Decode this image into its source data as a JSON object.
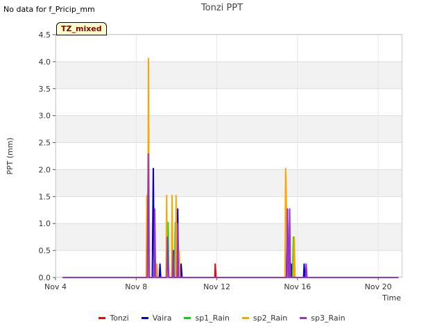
{
  "notice": "No data for f_Pricip_mm",
  "badge": "TZ_mixed",
  "chart_data": {
    "type": "line",
    "title": "Tonzi PPT",
    "xlabel": "Time",
    "ylabel": "PPT (mm)",
    "xlim": [
      4.3,
      21.5
    ],
    "ylim": [
      0,
      4.5
    ],
    "x_ticks": [
      {
        "value": 4.3,
        "label": "Nov 4"
      },
      {
        "value": 8.3,
        "label": "Nov 8"
      },
      {
        "value": 12.3,
        "label": "Nov 12"
      },
      {
        "value": 16.3,
        "label": "Nov 16"
      },
      {
        "value": 20.3,
        "label": "Nov 20"
      }
    ],
    "y_ticks": [
      "0.0",
      "0.5",
      "1.0",
      "1.5",
      "2.0",
      "2.5",
      "3.0",
      "3.5",
      "4.0",
      "4.5"
    ],
    "grid": true,
    "legend_position": "bottom",
    "series": [
      {
        "name": "Tonzi",
        "color": "#ff0000",
        "points": [
          [
            4.65,
            0
          ],
          [
            12.2,
            0
          ],
          [
            12.22,
            0.25
          ],
          [
            12.26,
            0
          ],
          [
            21.3,
            0
          ]
        ]
      },
      {
        "name": "Vaira",
        "color": "#0000cc",
        "points": [
          [
            4.65,
            0
          ],
          [
            8.85,
            0
          ],
          [
            8.88,
            0.75
          ],
          [
            8.92,
            0
          ],
          [
            9.1,
            0
          ],
          [
            9.15,
            2.02
          ],
          [
            9.19,
            0
          ],
          [
            9.45,
            0
          ],
          [
            9.48,
            0.25
          ],
          [
            9.52,
            0
          ],
          [
            10.15,
            0
          ],
          [
            10.2,
            0.5
          ],
          [
            10.25,
            0
          ],
          [
            10.32,
            0
          ],
          [
            10.36,
            1.27
          ],
          [
            10.4,
            0
          ],
          [
            10.5,
            0
          ],
          [
            10.53,
            0.25
          ],
          [
            10.57,
            0
          ],
          [
            15.75,
            0
          ],
          [
            15.8,
            1.27
          ],
          [
            15.85,
            0
          ],
          [
            15.95,
            0
          ],
          [
            15.99,
            0.25
          ],
          [
            16.03,
            0
          ],
          [
            16.6,
            0
          ],
          [
            16.63,
            0.25
          ],
          [
            16.67,
            0
          ],
          [
            21.3,
            0
          ]
        ]
      },
      {
        "name": "sp1_Rain",
        "color": "#00dd00",
        "points": [
          [
            4.65,
            0
          ],
          [
            8.88,
            0
          ],
          [
            8.92,
            2.79
          ],
          [
            8.96,
            0
          ],
          [
            9.85,
            0
          ],
          [
            9.88,
            1.02
          ],
          [
            9.92,
            0
          ],
          [
            10.2,
            0
          ],
          [
            10.24,
            1.02
          ],
          [
            10.28,
            0
          ],
          [
            16.05,
            0
          ],
          [
            16.1,
            0.75
          ],
          [
            16.14,
            0
          ],
          [
            21.3,
            0
          ]
        ]
      },
      {
        "name": "sp2_Rain",
        "color": "#ffa500",
        "points": [
          [
            4.65,
            0
          ],
          [
            8.8,
            0
          ],
          [
            8.83,
            1.52
          ],
          [
            8.87,
            0
          ],
          [
            8.88,
            0
          ],
          [
            8.91,
            4.06
          ],
          [
            8.95,
            0
          ],
          [
            9.3,
            0
          ],
          [
            9.33,
            0.25
          ],
          [
            9.37,
            0
          ],
          [
            9.78,
            0
          ],
          [
            9.81,
            1.52
          ],
          [
            9.85,
            0
          ],
          [
            10.05,
            0
          ],
          [
            10.08,
            1.52
          ],
          [
            10.12,
            0
          ],
          [
            10.25,
            0
          ],
          [
            10.28,
            1.52
          ],
          [
            10.32,
            0
          ],
          [
            10.4,
            0
          ],
          [
            10.43,
            0.5
          ],
          [
            10.47,
            0
          ],
          [
            15.68,
            0
          ],
          [
            15.71,
            2.02
          ],
          [
            15.74,
            1.5
          ],
          [
            15.8,
            0
          ],
          [
            16.1,
            0
          ],
          [
            16.14,
            0.75
          ],
          [
            16.18,
            0
          ],
          [
            21.3,
            0
          ]
        ]
      },
      {
        "name": "sp3_Rain",
        "color": "#9932cc",
        "points": [
          [
            4.65,
            0
          ],
          [
            8.85,
            0
          ],
          [
            8.87,
            0.75
          ],
          [
            8.9,
            2.29
          ],
          [
            8.94,
            0
          ],
          [
            9.18,
            0
          ],
          [
            9.22,
            1.27
          ],
          [
            9.26,
            0
          ],
          [
            9.82,
            0
          ],
          [
            9.85,
            0.75
          ],
          [
            9.88,
            0.25
          ],
          [
            9.92,
            0
          ],
          [
            10.1,
            0
          ],
          [
            10.13,
            0.5
          ],
          [
            10.17,
            0
          ],
          [
            10.33,
            0
          ],
          [
            10.36,
            1.0
          ],
          [
            10.4,
            0
          ],
          [
            15.76,
            0
          ],
          [
            15.8,
            1.27
          ],
          [
            15.84,
            0
          ],
          [
            15.88,
            0
          ],
          [
            15.91,
            1.27
          ],
          [
            15.95,
            0
          ],
          [
            16.7,
            0
          ],
          [
            16.73,
            0.25
          ],
          [
            16.77,
            0
          ],
          [
            21.3,
            0
          ]
        ]
      }
    ]
  }
}
